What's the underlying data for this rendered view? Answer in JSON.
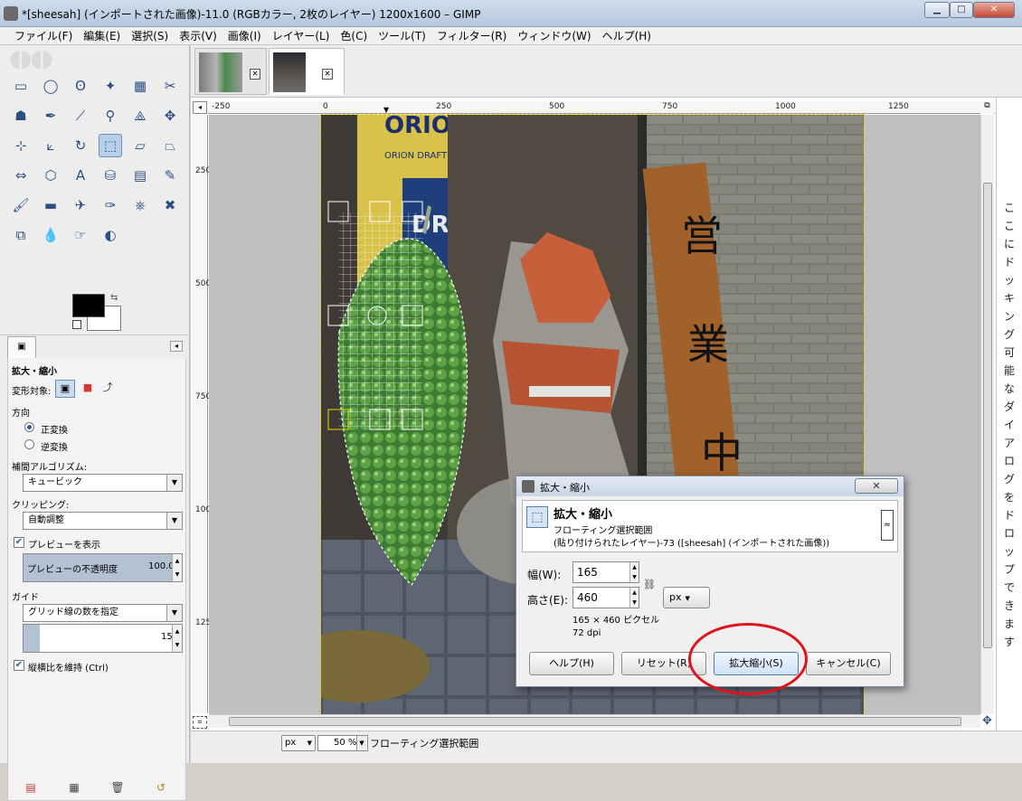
{
  "window": {
    "title": "*[sheesah] (インポートされた画像)-11.0 (RGBカラー, 2枚のレイヤー) 1200x1600 – GIMP",
    "minimize": "▁",
    "maximize": "□",
    "close": "✕"
  },
  "menu": [
    "ファイル(F)",
    "編集(E)",
    "選択(S)",
    "表示(V)",
    "画像(I)",
    "レイヤー(L)",
    "色(C)",
    "ツール(T)",
    "フィルター(R)",
    "ウィンドウ(W)",
    "ヘルプ(H)"
  ],
  "toolbox": {
    "tools": [
      {
        "name": "rect-select-icon",
        "glyph": "▭"
      },
      {
        "name": "ellipse-select-icon",
        "glyph": "◯"
      },
      {
        "name": "free-select-icon",
        "glyph": "ʘ"
      },
      {
        "name": "fuzzy-select-icon",
        "glyph": "✦"
      },
      {
        "name": "color-select-icon",
        "glyph": "▦"
      },
      {
        "name": "scissors-icon",
        "glyph": "✂"
      },
      {
        "name": "foreground-select-icon",
        "glyph": "☗"
      },
      {
        "name": "paths-icon",
        "glyph": "✒"
      },
      {
        "name": "color-picker-icon",
        "glyph": "⟋"
      },
      {
        "name": "zoom-icon",
        "glyph": "⚲"
      },
      {
        "name": "measure-icon",
        "glyph": "⟁"
      },
      {
        "name": "move-icon",
        "glyph": "✥"
      },
      {
        "name": "align-icon",
        "glyph": "⊹"
      },
      {
        "name": "crop-icon",
        "glyph": "⟀"
      },
      {
        "name": "rotate-icon",
        "glyph": "↻"
      },
      {
        "name": "scale-icon",
        "glyph": "⬚",
        "active": true
      },
      {
        "name": "shear-icon",
        "glyph": "▱"
      },
      {
        "name": "perspective-icon",
        "glyph": "⏢"
      },
      {
        "name": "flip-icon",
        "glyph": "⇔"
      },
      {
        "name": "cage-icon",
        "glyph": "⬡"
      },
      {
        "name": "text-icon",
        "glyph": "A"
      },
      {
        "name": "bucket-fill-icon",
        "glyph": "⛁"
      },
      {
        "name": "gradient-icon",
        "glyph": "▤"
      },
      {
        "name": "pencil-icon",
        "glyph": "✎"
      },
      {
        "name": "paintbrush-icon",
        "glyph": "🖌"
      },
      {
        "name": "eraser-icon",
        "glyph": "▬"
      },
      {
        "name": "airbrush-icon",
        "glyph": "✈"
      },
      {
        "name": "ink-icon",
        "glyph": "✑"
      },
      {
        "name": "clone-icon",
        "glyph": "⎈"
      },
      {
        "name": "heal-icon",
        "glyph": "✖"
      },
      {
        "name": "perspective-clone-icon",
        "glyph": "⧉"
      },
      {
        "name": "blur-icon",
        "glyph": "💧"
      },
      {
        "name": "smudge-icon",
        "glyph": "☞"
      },
      {
        "name": "dodge-burn-icon",
        "glyph": "◐"
      }
    ]
  },
  "options": {
    "title": "拡大・縮小",
    "transform_label": "変形対象:",
    "direction_label": "方向",
    "forward": "正変換",
    "backward": "逆変換",
    "interp_label": "補間アルゴリズム:",
    "interp_value": "キュービック",
    "clip_label": "クリッピング:",
    "clip_value": "自動調整",
    "preview_label": "プレビューを表示",
    "opacity_label": "プレビューの不透明度",
    "opacity_value": "100.0",
    "guide_label": "ガイド",
    "guide_value": "グリッド線の数を指定",
    "grid_count": "15",
    "keep_aspect": "縦横比を維持 (Ctrl)"
  },
  "rulers": {
    "h": [
      "-250",
      "0",
      "250",
      "500",
      "750",
      "1000",
      "1250"
    ],
    "v": [
      "250",
      "500",
      "750",
      "1000",
      "1250"
    ]
  },
  "statusbar": {
    "unit": "px",
    "zoom": "50 %",
    "message": "フローティング選択範囲"
  },
  "dock_hint": "ここにドッキング可能なダイアログをドロップできます",
  "dialog": {
    "title": "拡大・縮小",
    "close": "✕",
    "heading": "拡大・縮小",
    "sub1": "フローティング選択範囲",
    "sub2": "(貼り付けられたレイヤー)-73 ([sheesah] (インポートされた画像))",
    "width_label": "幅(W):",
    "width_value": "165",
    "height_label": "高さ(E):",
    "height_value": "460",
    "unit": "px",
    "size_info": "165 × 460 ピクセル",
    "dpi": "72 dpi",
    "btn_help": "ヘルプ(H)",
    "btn_reset": "リセット(R)",
    "btn_scale": "拡大縮小(S)",
    "btn_cancel": "キャンセル(C)"
  },
  "colors": {
    "highlight": "#e0121b",
    "selection": "#e6d500",
    "active_tool": "#b8cfe8"
  }
}
